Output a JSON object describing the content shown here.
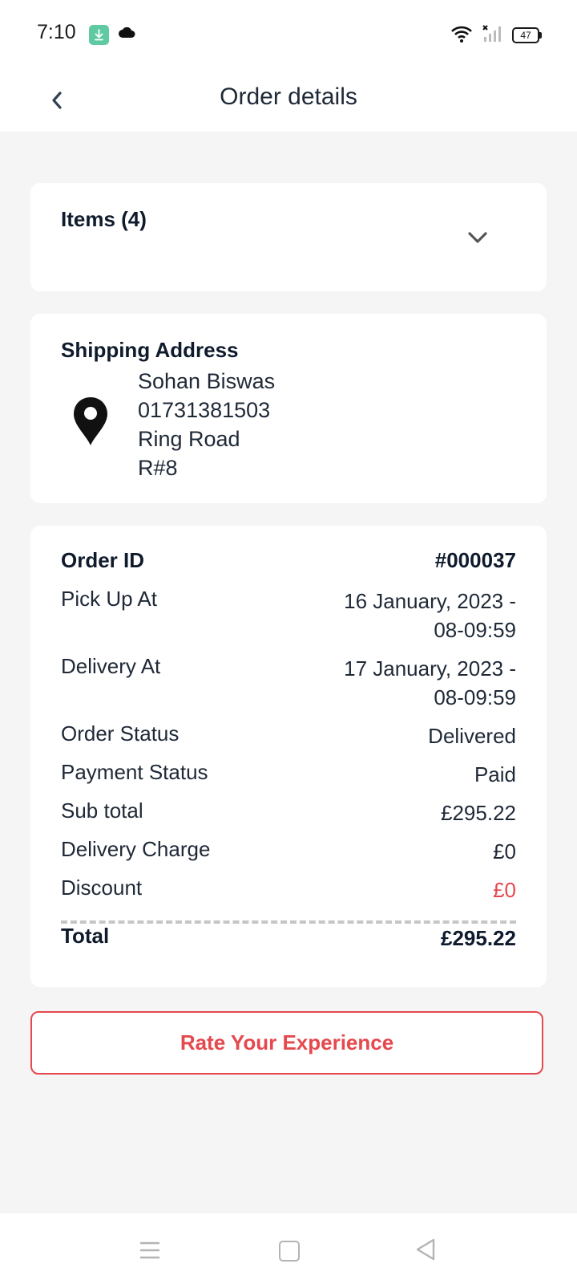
{
  "status_bar": {
    "time": "7:10",
    "battery": "47",
    "icons": [
      "download-icon",
      "cloud-icon",
      "wifi-icon",
      "signal-icon",
      "battery-icon"
    ]
  },
  "header": {
    "title": "Order details",
    "back_icon": "chevron-left-icon"
  },
  "items": {
    "title": "Items (4)",
    "expand_icon": "chevron-down-icon"
  },
  "shipping": {
    "title": "Shipping Address",
    "icon": "location-pin-icon",
    "name": "Sohan Biswas",
    "phone": "01731381503",
    "line1": "Ring Road",
    "line2": "R#8"
  },
  "summary": {
    "order_id_label": "Order ID",
    "order_id_value": "#000037",
    "pickup_label": "Pick Up At",
    "pickup_date": "16 January, 2023 -",
    "pickup_time": "08-09:59",
    "delivery_label": "Delivery At",
    "delivery_date": "17 January, 2023 -",
    "delivery_time": "08-09:59",
    "order_status_label": "Order Status",
    "order_status_value": "Delivered",
    "payment_status_label": "Payment Status",
    "payment_status_value": "Paid",
    "subtotal_label": "Sub total",
    "subtotal_value": "£295.22",
    "delivery_charge_label": "Delivery Charge",
    "delivery_charge_value": "£0",
    "discount_label": "Discount",
    "discount_value": "£0",
    "total_label": "Total",
    "total_value": "£295.22"
  },
  "rate_button": {
    "label": "Rate Your Experience"
  },
  "colors": {
    "accent": "#e5484d",
    "background": "#f5f5f5",
    "card": "#ffffff",
    "text_dark": "#0f1b2d"
  },
  "nav_bar": {
    "icons": [
      "menu-icon",
      "home-square-icon",
      "back-triangle-icon"
    ]
  }
}
